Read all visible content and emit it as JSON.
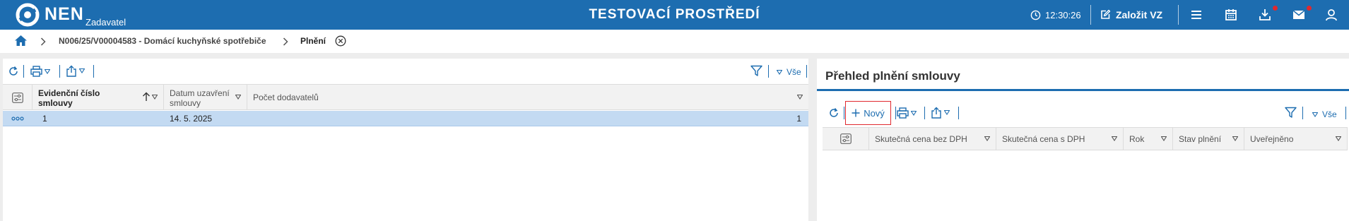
{
  "app": {
    "logo_text": "NEN",
    "logo_subtitle": "Zadavatel",
    "environment_title": "TESTOVACÍ PROSTŘEDÍ",
    "time": "12:30:26",
    "create_button": "Založit VZ"
  },
  "breadcrumb": {
    "items": [
      {
        "label": "N006/25/V00004583 - Domácí kuchyňské spotřebiče"
      },
      {
        "label": "Plnění"
      }
    ]
  },
  "left_grid": {
    "filter_label": "Vše",
    "columns": [
      {
        "label": "Evidenční číslo smlouvy"
      },
      {
        "label": "Datum uzavření smlouvy"
      },
      {
        "label": "Počet dodavatelů"
      }
    ],
    "rows": [
      {
        "cells": [
          "1",
          "14. 5. 2025",
          "1"
        ]
      }
    ]
  },
  "right_panel": {
    "title": "Přehled plnění smlouvy",
    "new_button": "Nový",
    "filter_label": "Vše",
    "columns": [
      {
        "label": "Skutečná cena bez DPH"
      },
      {
        "label": "Skutečná cena s DPH"
      },
      {
        "label": "Rok"
      },
      {
        "label": "Stav plnění"
      },
      {
        "label": "Uveřejněno"
      }
    ]
  },
  "colors": {
    "brand_blue": "#1d6db0",
    "selected_row": "#c3daf2",
    "highlight_red": "#e0282e"
  }
}
